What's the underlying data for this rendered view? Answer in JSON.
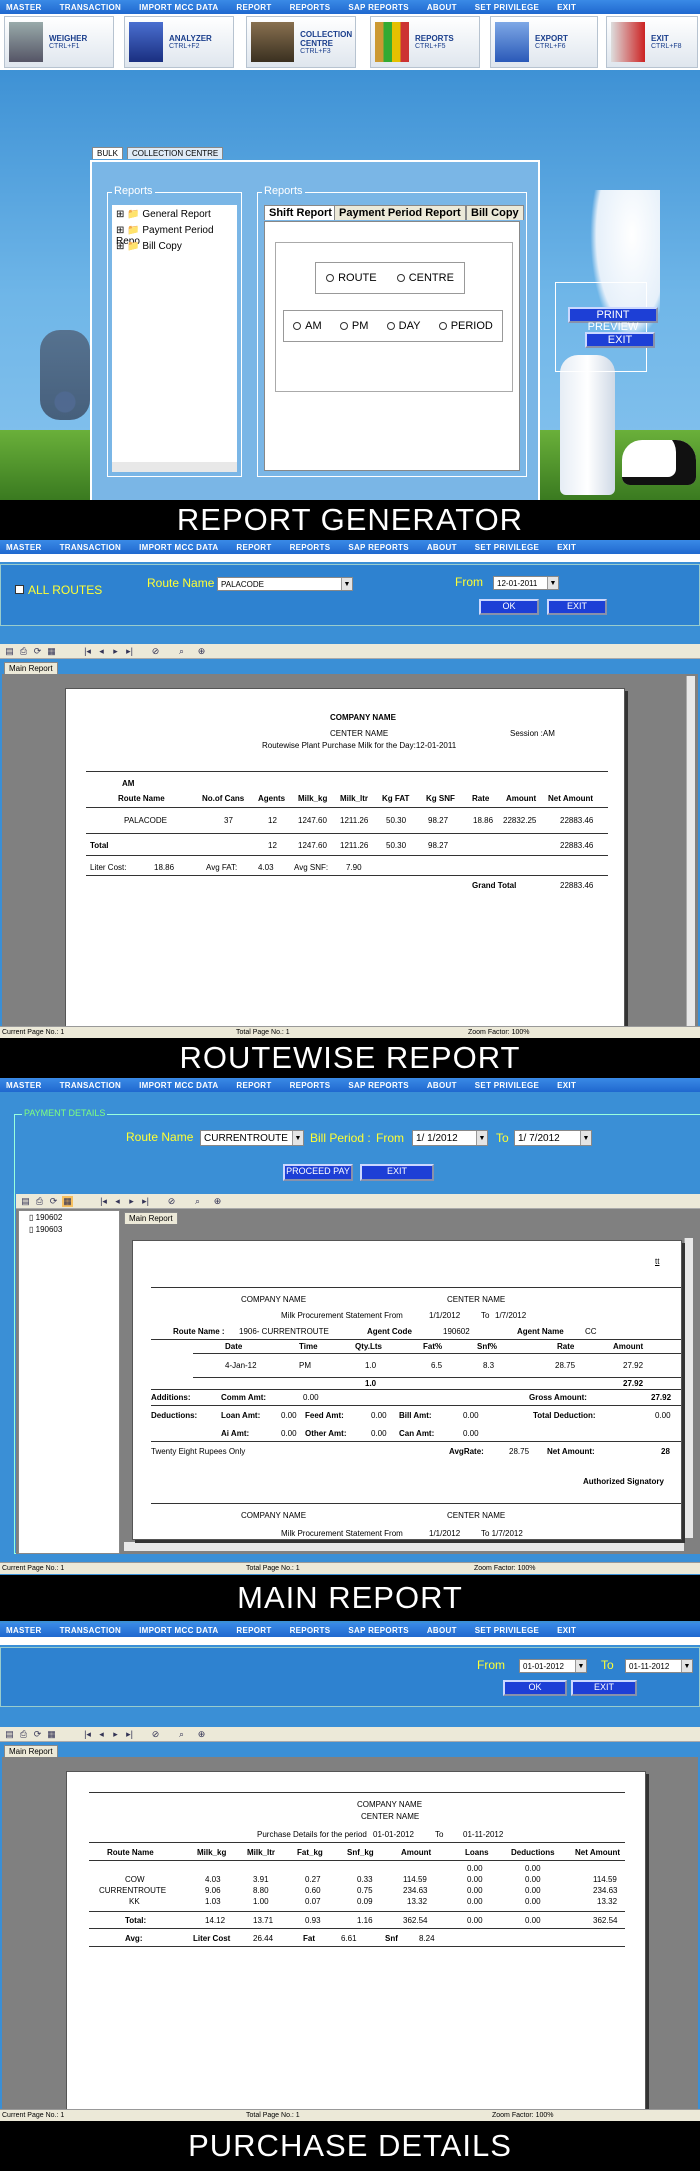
{
  "menu": [
    "MASTER",
    "TRANSACTION",
    "IMPORT MCC DATA",
    "REPORT",
    "REPORTS",
    "SAP REPORTS",
    "ABOUT",
    "SET PRIVILEGE",
    "EXIT"
  ],
  "toolbar": [
    {
      "label": "WEIGHER",
      "key": "CTRL+F1"
    },
    {
      "label": "ANALYZER",
      "key": "CTRL+F2"
    },
    {
      "label": "COLLECTION CENTRE",
      "key": "CTRL+F3"
    },
    {
      "label": "REPORTS",
      "key": "CTRL+F5"
    },
    {
      "label": "EXPORT",
      "key": "CTRL+F6"
    },
    {
      "label": "EXIT",
      "key": "CTRL+F8"
    }
  ],
  "s1": {
    "tabs": [
      "BULK",
      "COLLECTION CENTRE"
    ],
    "left_group": "Reports",
    "right_group": "Reports",
    "tree": [
      "General Report",
      "Payment Period Repo",
      "Bill Copy"
    ],
    "rtabs": [
      "Shift Report",
      "Payment Period Report",
      "Bill Copy"
    ],
    "opt1": [
      "ROUTE",
      "CENTRE"
    ],
    "opt2": [
      "AM",
      "PM",
      "DAY",
      "PERIOD"
    ],
    "print_preview": "PRINT PREVIEW",
    "exit": "EXIT",
    "banner": "REPORT GENERATOR"
  },
  "s2": {
    "all_routes": "ALL ROUTES",
    "route_label": "Route Name",
    "route_value": "PALACODE",
    "from_label": "From",
    "from_value": "12-01-2011",
    "ok": "OK",
    "exit": "EXIT",
    "tab": "Main Report",
    "company": "COMPANY NAME",
    "center": "CENTER NAME",
    "subtitle": "Routewise Plant Purchase Milk for the Day:12-01-2011",
    "session": "Session :AM",
    "shift": "AM",
    "cols": [
      "Route Name",
      "No.of Cans",
      "Agents",
      "Milk_kg",
      "Milk_ltr",
      "Kg FAT",
      "Kg SNF",
      "Rate",
      "Amount",
      "Net Amount"
    ],
    "row": [
      "PALACODE",
      "37",
      "12",
      "1247.60",
      "1211.26",
      "50.30",
      "98.27",
      "18.86",
      "22832.25",
      "22883.46"
    ],
    "total": [
      "Total",
      "12",
      "1247.60",
      "1211.26",
      "50.30",
      "98.27",
      "22883.46"
    ],
    "liter_cost_label": "Liter Cost:",
    "liter_cost": "18.86",
    "avg_fat_label": "Avg FAT:",
    "avg_fat": "4.03",
    "avg_snf_label": "Avg SNF:",
    "avg_snf": "7.90",
    "grand_total_label": "Grand Total",
    "grand_total": "22883.46",
    "status": [
      "Current Page No.: 1",
      "Total Page No.: 1",
      "Zoom Factor: 100%"
    ],
    "banner": "ROUTEWISE REPORT"
  },
  "s3": {
    "group": "PAYMENT DETAILS",
    "route_label": "Route Name",
    "route_value": "CURRENTROUTE",
    "bill_label": "Bill Period :",
    "from_label": "From",
    "from_value": "1/ 1/2012",
    "to_label": "To",
    "to_value": "1/ 7/2012",
    "proceed": "PROCEED PAY",
    "exit": "EXIT",
    "tree": [
      "190602",
      "190603"
    ],
    "tab": "Main Report",
    "corner": "tt",
    "company": "COMPANY NAME",
    "center": "CENTER NAME",
    "stmt": "Milk Procurement Statement From",
    "stmt_from": "1/1/2012",
    "stmt_to_label": "To",
    "stmt_to": "1/7/2012",
    "route_name_label": "Route Name :",
    "route_name": "1906- CURRENTROUTE",
    "agent_code_label": "Agent Code",
    "agent_code": "190602",
    "agent_name_label": "Agent Name",
    "agent_name": "CC",
    "cols": [
      "Date",
      "Time",
      "Qty.Lts",
      "Fat%",
      "Snf%",
      "Rate",
      "Amount"
    ],
    "row": [
      "4-Jan-12",
      "PM",
      "1.0",
      "6.5",
      "8.3",
      "28.75",
      "27.92"
    ],
    "sub_qty": "1.0",
    "sub_amt": "27.92",
    "additions": "Additions:",
    "comm": "Comm Amt:",
    "comm_v": "0.00",
    "gross": "Gross Amount:",
    "gross_v": "27.92",
    "deductions": "Deductions:",
    "loan": "Loan Amt:",
    "loan_v": "0.00",
    "feed": "Feed Amt:",
    "feed_v": "0.00",
    "bill": "Bill Amt:",
    "bill_v": "0.00",
    "total_ded": "Total Deduction:",
    "total_ded_v": "0.00",
    "ai": "Ai Amt:",
    "ai_v": "0.00",
    "other": "Other Amt:",
    "other_v": "0.00",
    "can": "Can Amt:",
    "can_v": "0.00",
    "words": "Twenty Eight  Rupees Only",
    "avgrate": "AvgRate:",
    "avgrate_v": "28.75",
    "net": "Net Amount:",
    "net_v": "28",
    "signatory": "Authorized Signatory",
    "company2": "COMPANY NAME",
    "center2": "CENTER NAME",
    "stmt2": "Milk Procurement Statement From",
    "stmt2_from": "1/1/2012",
    "stmt2_to": "To  1/7/2012",
    "status": [
      "Current Page No.: 1",
      "Total Page No.: 1",
      "Zoom Factor: 100%"
    ],
    "banner": "MAIN REPORT"
  },
  "s4": {
    "from_label": "From",
    "from_value": "01-01-2012",
    "to_label": "To",
    "to_value": "01-11-2012",
    "ok": "OK",
    "exit": "EXIT",
    "tab": "Main Report",
    "company": "COMPANY NAME",
    "center": "CENTER NAME",
    "period_label": "Purchase Details for the period",
    "period_from": "01-01-2012",
    "period_to_label": "To",
    "period_to": "01-11-2012",
    "cols": [
      "Route  Name",
      "Milk_kg",
      "Milk_ltr",
      "Fat_kg",
      "Snf_kg",
      "Amount",
      "Loans",
      "Deductions",
      "Net Amount"
    ],
    "rows": [
      [
        "",
        "",
        "",
        "",
        "",
        "",
        "0.00",
        "0.00",
        ""
      ],
      [
        "COW",
        "4.03",
        "3.91",
        "0.27",
        "0.33",
        "114.59",
        "0.00",
        "0.00",
        "114.59"
      ],
      [
        "CURRENTROUTE",
        "9.06",
        "8.80",
        "0.60",
        "0.75",
        "234.63",
        "0.00",
        "0.00",
        "234.63"
      ],
      [
        "KK",
        "1.03",
        "1.00",
        "0.07",
        "0.09",
        "13.32",
        "0.00",
        "0.00",
        "13.32"
      ]
    ],
    "total": [
      "Total:",
      "14.12",
      "13.71",
      "0.93",
      "1.16",
      "362.54",
      "0.00",
      "0.00",
      "362.54"
    ],
    "avg_label": "Avg:",
    "liter_cost_label": "Liter Cost",
    "liter_cost": "26.44",
    "fat_label": "Fat",
    "fat": "6.61",
    "snf_label": "Snf",
    "snf": "8.24",
    "status": [
      "Current Page No.: 1",
      "Total Page No.: 1",
      "Zoom Factor: 100%"
    ],
    "banner": "PURCHASE DETAILS"
  }
}
